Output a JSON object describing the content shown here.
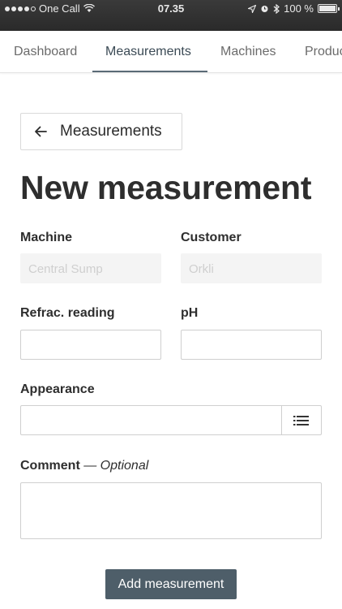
{
  "status_bar": {
    "carrier": "One Call",
    "time": "07.35",
    "battery": "100 %",
    "battery_level": 1.0
  },
  "tabs": [
    {
      "label": "Dashboard",
      "active": false
    },
    {
      "label": "Measurements",
      "active": true
    },
    {
      "label": "Machines",
      "active": false
    },
    {
      "label": "Produc",
      "active": false
    }
  ],
  "back_button": {
    "label": "Measurements",
    "icon": "arrow-left-icon"
  },
  "page_title": "New measurement",
  "form": {
    "machine": {
      "label": "Machine",
      "value": "Central Sump"
    },
    "customer": {
      "label": "Customer",
      "value": "Orkli"
    },
    "refrac": {
      "label": "Refrac. reading",
      "value": ""
    },
    "ph": {
      "label": "pH",
      "value": ""
    },
    "appearance": {
      "label": "Appearance",
      "value": "",
      "icon": "list-icon"
    },
    "comment": {
      "label": "Comment",
      "optional": "— Optional",
      "value": ""
    },
    "submit_label": "Add measurement"
  },
  "colors": {
    "status_bar_bg": "#2e2e2e",
    "active_tab_underline": "#5a6a76",
    "primary_button": "#4e5e69"
  }
}
